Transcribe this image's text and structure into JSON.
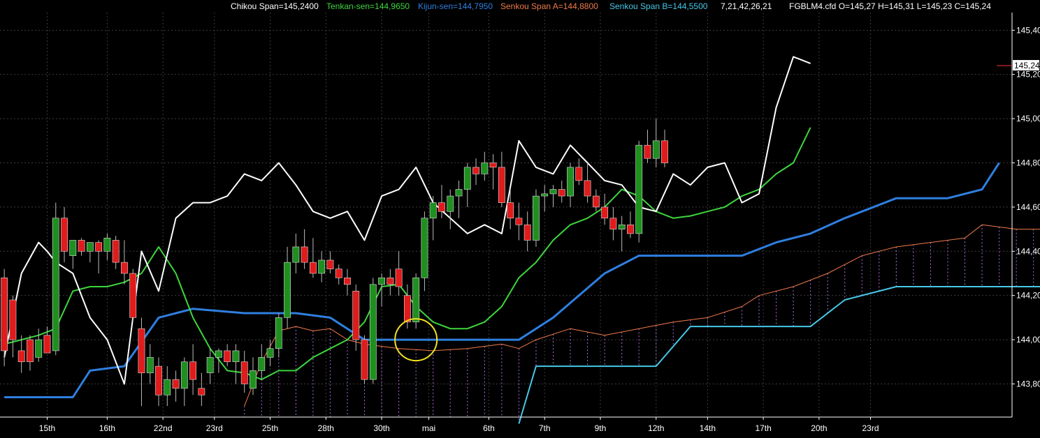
{
  "legend": {
    "chikou": "Chikou Span=145,2400",
    "tenkan": "Tenkan-sen=144,9650",
    "kijun": "Kijun-sen=144,7950",
    "senkouA": "Senkou Span A=144,8800",
    "senkouB": "Senkou Span B=144,5500",
    "params": "7,21,42,26,21",
    "ohlc": "FGBLM4.cfd O=145,27 H=145,31 L=145,23 C=145,24"
  },
  "colors": {
    "background": "#000000",
    "grid": "#3c3c3c",
    "axis": "#ffffff",
    "bull": "#1f8f1f",
    "bear": "#e01b1b",
    "chikou": "#ffffff",
    "tenkan": "#3dd63d",
    "kijun": "#2f7fe0",
    "senkouA": "#f07a4a",
    "senkouB": "#46c8e8",
    "cloud": "#b070e0",
    "marker": "#f0e020",
    "lastPrice": "#ff3030"
  },
  "chart_data": {
    "type": "candlestick",
    "title": "",
    "ylim": [
      143.65,
      145.48
    ],
    "y_ticks": [
      "145,40",
      "145,20",
      "145,00",
      "144,80",
      "144,60",
      "144,40",
      "144,20",
      "144,00",
      "143,80"
    ],
    "y_tick_values": [
      145.4,
      145.2,
      145.0,
      144.8,
      144.6,
      144.4,
      144.2,
      144.0,
      143.8
    ],
    "last_price_label": "145,24",
    "last_price": 145.24,
    "x_labels": [
      "15th",
      "16th",
      "22nd",
      "23rd",
      "25th",
      "28th",
      "30th",
      "mai",
      "6th",
      "7th",
      "9th",
      "12th",
      "14th",
      "17th",
      "20th",
      "23rd"
    ],
    "x_label_bars": [
      5,
      12,
      18.5,
      24.5,
      31,
      37.5,
      44,
      49.5,
      56.5,
      63,
      69.5,
      76,
      82,
      88.5,
      95,
      101
    ],
    "bars_total": 118,
    "candles": [
      {
        "o": 144.28,
        "h": 144.32,
        "l": 143.88,
        "c": 143.95
      },
      {
        "o": 144.18,
        "h": 144.2,
        "l": 143.92,
        "c": 144.0
      },
      {
        "o": 143.95,
        "h": 144.02,
        "l": 143.85,
        "c": 143.9
      },
      {
        "o": 144.0,
        "h": 144.02,
        "l": 143.86,
        "c": 143.9
      },
      {
        "o": 143.92,
        "h": 144.05,
        "l": 143.9,
        "c": 144.0
      },
      {
        "o": 144.02,
        "h": 144.06,
        "l": 143.95,
        "c": 143.94
      },
      {
        "o": 143.95,
        "h": 144.62,
        "l": 143.93,
        "c": 144.55
      },
      {
        "o": 144.55,
        "h": 144.6,
        "l": 144.35,
        "c": 144.4
      },
      {
        "o": 144.38,
        "h": 144.45,
        "l": 144.32,
        "c": 144.45
      },
      {
        "o": 144.45,
        "h": 144.46,
        "l": 144.38,
        "c": 144.4
      },
      {
        "o": 144.4,
        "h": 144.44,
        "l": 144.35,
        "c": 144.44
      },
      {
        "o": 144.44,
        "h": 144.45,
        "l": 144.3,
        "c": 144.4
      },
      {
        "o": 144.4,
        "h": 144.48,
        "l": 144.36,
        "c": 144.46
      },
      {
        "o": 144.45,
        "h": 144.47,
        "l": 144.32,
        "c": 144.35
      },
      {
        "o": 144.35,
        "h": 144.45,
        "l": 144.25,
        "c": 144.3
      },
      {
        "o": 144.3,
        "h": 144.32,
        "l": 144.08,
        "c": 144.1
      },
      {
        "o": 144.05,
        "h": 144.1,
        "l": 143.7,
        "c": 143.85
      },
      {
        "o": 143.85,
        "h": 143.98,
        "l": 143.8,
        "c": 143.92
      },
      {
        "o": 143.88,
        "h": 143.92,
        "l": 143.7,
        "c": 143.75
      },
      {
        "o": 143.75,
        "h": 143.88,
        "l": 143.7,
        "c": 143.82
      },
      {
        "o": 143.82,
        "h": 143.86,
        "l": 143.72,
        "c": 143.78
      },
      {
        "o": 143.78,
        "h": 143.92,
        "l": 143.7,
        "c": 143.9
      },
      {
        "o": 143.9,
        "h": 143.98,
        "l": 143.75,
        "c": 143.82
      },
      {
        "o": 143.78,
        "h": 143.85,
        "l": 143.7,
        "c": 143.75
      },
      {
        "o": 143.85,
        "h": 143.96,
        "l": 143.8,
        "c": 143.92
      },
      {
        "o": 143.92,
        "h": 143.96,
        "l": 143.85,
        "c": 143.95
      },
      {
        "o": 143.95,
        "h": 143.98,
        "l": 143.88,
        "c": 143.9
      },
      {
        "o": 143.9,
        "h": 143.98,
        "l": 143.8,
        "c": 143.95
      },
      {
        "o": 143.9,
        "h": 143.95,
        "l": 143.76,
        "c": 143.8
      },
      {
        "o": 143.78,
        "h": 143.92,
        "l": 143.75,
        "c": 143.86
      },
      {
        "o": 143.86,
        "h": 143.98,
        "l": 143.82,
        "c": 143.92
      },
      {
        "o": 143.92,
        "h": 144.0,
        "l": 143.88,
        "c": 143.96
      },
      {
        "o": 143.96,
        "h": 144.12,
        "l": 143.92,
        "c": 144.1
      },
      {
        "o": 144.1,
        "h": 144.42,
        "l": 144.05,
        "c": 144.35
      },
      {
        "o": 144.35,
        "h": 144.48,
        "l": 144.3,
        "c": 144.42
      },
      {
        "o": 144.42,
        "h": 144.5,
        "l": 144.32,
        "c": 144.35
      },
      {
        "o": 144.35,
        "h": 144.46,
        "l": 144.28,
        "c": 144.3
      },
      {
        "o": 144.3,
        "h": 144.4,
        "l": 144.26,
        "c": 144.36
      },
      {
        "o": 144.36,
        "h": 144.4,
        "l": 144.3,
        "c": 144.32
      },
      {
        "o": 144.32,
        "h": 144.34,
        "l": 144.25,
        "c": 144.28
      },
      {
        "o": 144.28,
        "h": 144.32,
        "l": 144.2,
        "c": 144.25
      },
      {
        "o": 144.22,
        "h": 144.25,
        "l": 143.95,
        "c": 144.0
      },
      {
        "o": 144.0,
        "h": 144.02,
        "l": 143.8,
        "c": 143.82
      },
      {
        "o": 143.82,
        "h": 144.28,
        "l": 143.8,
        "c": 144.25
      },
      {
        "o": 144.25,
        "h": 144.3,
        "l": 144.15,
        "c": 144.28
      },
      {
        "o": 144.28,
        "h": 144.32,
        "l": 144.2,
        "c": 144.25
      },
      {
        "o": 144.32,
        "h": 144.4,
        "l": 144.2,
        "c": 144.24
      },
      {
        "o": 144.2,
        "h": 144.25,
        "l": 144.05,
        "c": 144.08
      },
      {
        "o": 144.08,
        "h": 144.3,
        "l": 144.05,
        "c": 144.28
      },
      {
        "o": 144.28,
        "h": 144.58,
        "l": 144.22,
        "c": 144.55
      },
      {
        "o": 144.55,
        "h": 144.65,
        "l": 144.45,
        "c": 144.62
      },
      {
        "o": 144.62,
        "h": 144.7,
        "l": 144.55,
        "c": 144.58
      },
      {
        "o": 144.58,
        "h": 144.68,
        "l": 144.5,
        "c": 144.65
      },
      {
        "o": 144.65,
        "h": 144.72,
        "l": 144.55,
        "c": 144.68
      },
      {
        "o": 144.68,
        "h": 144.8,
        "l": 144.6,
        "c": 144.78
      },
      {
        "o": 144.78,
        "h": 144.82,
        "l": 144.7,
        "c": 144.75
      },
      {
        "o": 144.75,
        "h": 144.85,
        "l": 144.72,
        "c": 144.8
      },
      {
        "o": 144.8,
        "h": 144.84,
        "l": 144.68,
        "c": 144.78
      },
      {
        "o": 144.78,
        "h": 144.85,
        "l": 144.6,
        "c": 144.62
      },
      {
        "o": 144.62,
        "h": 144.68,
        "l": 144.5,
        "c": 144.55
      },
      {
        "o": 144.55,
        "h": 144.62,
        "l": 144.45,
        "c": 144.52
      },
      {
        "o": 144.52,
        "h": 144.58,
        "l": 144.4,
        "c": 144.45
      },
      {
        "o": 144.45,
        "h": 144.68,
        "l": 144.42,
        "c": 144.65
      },
      {
        "o": 144.65,
        "h": 144.7,
        "l": 144.58,
        "c": 144.66
      },
      {
        "o": 144.66,
        "h": 144.7,
        "l": 144.6,
        "c": 144.68
      },
      {
        "o": 144.68,
        "h": 144.72,
        "l": 144.62,
        "c": 144.65
      },
      {
        "o": 144.65,
        "h": 144.8,
        "l": 144.6,
        "c": 144.78
      },
      {
        "o": 144.78,
        "h": 144.82,
        "l": 144.7,
        "c": 144.72
      },
      {
        "o": 144.72,
        "h": 144.8,
        "l": 144.62,
        "c": 144.65
      },
      {
        "o": 144.65,
        "h": 144.68,
        "l": 144.58,
        "c": 144.6
      },
      {
        "o": 144.6,
        "h": 144.66,
        "l": 144.52,
        "c": 144.55
      },
      {
        "o": 144.55,
        "h": 144.6,
        "l": 144.45,
        "c": 144.5
      },
      {
        "o": 144.5,
        "h": 144.56,
        "l": 144.4,
        "c": 144.52
      },
      {
        "o": 144.52,
        "h": 144.58,
        "l": 144.46,
        "c": 144.48
      },
      {
        "o": 144.48,
        "h": 144.9,
        "l": 144.44,
        "c": 144.88
      },
      {
        "o": 144.88,
        "h": 144.95,
        "l": 144.8,
        "c": 144.82
      },
      {
        "o": 144.82,
        "h": 145.0,
        "l": 144.78,
        "c": 144.9
      },
      {
        "o": 144.9,
        "h": 144.95,
        "l": 144.78,
        "c": 144.8
      }
    ],
    "chikou": [
      [
        0,
        143.92
      ],
      [
        2,
        144.3
      ],
      [
        4,
        144.44
      ],
      [
        5,
        144.4
      ],
      [
        6,
        144.35
      ],
      [
        8,
        144.3
      ],
      [
        10,
        144.1
      ],
      [
        12,
        144.0
      ],
      [
        14,
        143.8
      ],
      [
        16,
        144.4
      ],
      [
        18,
        144.22
      ],
      [
        20,
        144.55
      ],
      [
        22,
        144.62
      ],
      [
        24,
        144.62
      ],
      [
        26,
        144.65
      ],
      [
        28,
        144.75
      ],
      [
        30,
        144.72
      ],
      [
        32,
        144.8
      ],
      [
        34,
        144.7
      ],
      [
        36,
        144.58
      ],
      [
        38,
        144.55
      ],
      [
        40,
        144.58
      ],
      [
        42,
        144.45
      ],
      [
        44,
        144.65
      ],
      [
        46,
        144.68
      ],
      [
        48,
        144.78
      ],
      [
        50,
        144.62
      ],
      [
        52,
        144.55
      ],
      [
        54,
        144.48
      ],
      [
        56,
        144.52
      ],
      [
        58,
        144.48
      ],
      [
        60,
        144.9
      ],
      [
        62,
        144.78
      ],
      [
        64,
        144.75
      ],
      [
        66,
        144.88
      ],
      [
        68,
        144.8
      ],
      [
        70,
        144.72
      ],
      [
        72,
        144.7
      ],
      [
        74,
        144.6
      ],
      [
        76,
        144.58
      ],
      [
        78,
        144.75
      ],
      [
        80,
        144.7
      ],
      [
        82,
        144.78
      ],
      [
        84,
        144.8
      ],
      [
        86,
        144.62
      ],
      [
        88,
        144.66
      ],
      [
        90,
        145.05
      ],
      [
        92,
        145.28
      ],
      [
        94,
        145.25
      ]
    ],
    "tenkan": [
      [
        0,
        143.98
      ],
      [
        2,
        144.0
      ],
      [
        4,
        144.02
      ],
      [
        6,
        144.05
      ],
      [
        8,
        144.22
      ],
      [
        10,
        144.24
      ],
      [
        12,
        144.24
      ],
      [
        14,
        144.26
      ],
      [
        16,
        144.3
      ],
      [
        18,
        144.42
      ],
      [
        20,
        144.3
      ],
      [
        22,
        144.1
      ],
      [
        24,
        143.96
      ],
      [
        26,
        143.86
      ],
      [
        28,
        143.85
      ],
      [
        30,
        143.82
      ],
      [
        32,
        143.86
      ],
      [
        34,
        143.86
      ],
      [
        36,
        143.92
      ],
      [
        38,
        143.96
      ],
      [
        40,
        144.0
      ],
      [
        42,
        144.08
      ],
      [
        44,
        144.24
      ],
      [
        46,
        144.25
      ],
      [
        48,
        144.15
      ],
      [
        50,
        144.08
      ],
      [
        52,
        144.05
      ],
      [
        54,
        144.05
      ],
      [
        56,
        144.08
      ],
      [
        58,
        144.15
      ],
      [
        60,
        144.28
      ],
      [
        62,
        144.35
      ],
      [
        64,
        144.45
      ],
      [
        66,
        144.52
      ],
      [
        68,
        144.55
      ],
      [
        70,
        144.6
      ],
      [
        72,
        144.68
      ],
      [
        74,
        144.65
      ],
      [
        76,
        144.58
      ],
      [
        78,
        144.55
      ],
      [
        80,
        144.56
      ],
      [
        82,
        144.58
      ],
      [
        84,
        144.6
      ],
      [
        86,
        144.65
      ],
      [
        88,
        144.68
      ],
      [
        90,
        144.75
      ],
      [
        92,
        144.8
      ],
      [
        94,
        144.96
      ]
    ],
    "kijun": [
      [
        0,
        143.74
      ],
      [
        8,
        143.74
      ],
      [
        10,
        143.86
      ],
      [
        14,
        143.88
      ],
      [
        18,
        144.1
      ],
      [
        22,
        144.14
      ],
      [
        28,
        144.12
      ],
      [
        34,
        144.12
      ],
      [
        38,
        144.1
      ],
      [
        42,
        144.0
      ],
      [
        48,
        144.0
      ],
      [
        56,
        144.0
      ],
      [
        60,
        144.0
      ],
      [
        64,
        144.1
      ],
      [
        70,
        144.3
      ],
      [
        74,
        144.38
      ],
      [
        80,
        144.38
      ],
      [
        86,
        144.38
      ],
      [
        90,
        144.44
      ],
      [
        94,
        144.48
      ],
      [
        98,
        144.55
      ],
      [
        104,
        144.64
      ],
      [
        110,
        144.64
      ],
      [
        114,
        144.68
      ],
      [
        116,
        144.8
      ]
    ],
    "senkouA": [
      [
        28,
        143.7
      ],
      [
        30,
        143.9
      ],
      [
        32,
        144.04
      ],
      [
        34,
        144.06
      ],
      [
        36,
        144.04
      ],
      [
        38,
        144.05
      ],
      [
        40,
        144.0
      ],
      [
        42,
        143.98
      ],
      [
        46,
        143.96
      ],
      [
        50,
        143.95
      ],
      [
        54,
        143.96
      ],
      [
        58,
        143.98
      ],
      [
        60,
        143.96
      ],
      [
        62,
        144.0
      ],
      [
        66,
        144.05
      ],
      [
        70,
        144.02
      ],
      [
        74,
        144.05
      ],
      [
        78,
        144.08
      ],
      [
        82,
        144.1
      ],
      [
        86,
        144.15
      ],
      [
        88,
        144.2
      ],
      [
        92,
        144.24
      ],
      [
        96,
        144.3
      ],
      [
        100,
        144.38
      ],
      [
        104,
        144.42
      ],
      [
        108,
        144.44
      ],
      [
        112,
        144.46
      ],
      [
        114,
        144.52
      ],
      [
        118,
        144.5
      ],
      [
        122,
        144.5
      ],
      [
        126,
        144.5
      ],
      [
        130,
        144.52
      ],
      [
        134,
        144.55
      ],
      [
        138,
        144.58
      ],
      [
        142,
        144.62
      ],
      [
        146,
        144.68
      ],
      [
        150,
        144.72
      ],
      [
        152,
        144.88
      ]
    ],
    "senkouB": [
      [
        60,
        143.62
      ],
      [
        62,
        143.88
      ],
      [
        68,
        143.88
      ],
      [
        76,
        143.88
      ],
      [
        80,
        144.06
      ],
      [
        88,
        144.06
      ],
      [
        94,
        144.06
      ],
      [
        98,
        144.18
      ],
      [
        104,
        144.24
      ],
      [
        110,
        144.24
      ],
      [
        114,
        144.24
      ],
      [
        118,
        144.24
      ],
      [
        122,
        144.24
      ],
      [
        128,
        144.24
      ],
      [
        132,
        144.24
      ],
      [
        136,
        144.26
      ],
      [
        140,
        144.4
      ],
      [
        146,
        144.4
      ],
      [
        150,
        144.45
      ],
      [
        152,
        144.55
      ]
    ],
    "highlight_circle": {
      "bar": 48,
      "price": 144.0
    }
  }
}
